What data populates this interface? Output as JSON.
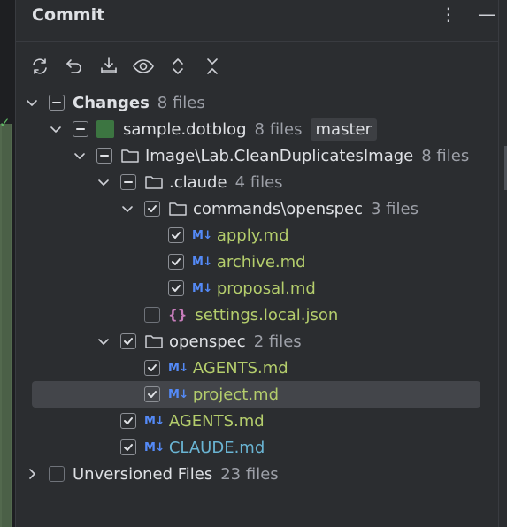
{
  "panel": {
    "title": "Commit",
    "more_icon": "more-vertical-icon",
    "minimize_icon": "minimize-icon"
  },
  "toolbar": {
    "icons": [
      "refresh-icon",
      "rollback-icon",
      "shelve-icon",
      "preview-icon",
      "expand-all-icon",
      "collapse-all-icon"
    ]
  },
  "tree": {
    "changes": {
      "label": "Changes",
      "count": "8 files"
    },
    "module": {
      "label": "sample.dotblog",
      "count": "8 files",
      "branch": "master"
    },
    "image_folder": {
      "label": "Image\\Lab.CleanDuplicatesImage",
      "count": "8 files"
    },
    "claude_folder": {
      "label": ".claude",
      "count": "4 files"
    },
    "commands_folder": {
      "label": "commands\\openspec",
      "count": "3 files"
    },
    "apply": {
      "label": "apply.md",
      "icon": "M↓"
    },
    "archive": {
      "label": "archive.md",
      "icon": "M↓"
    },
    "proposal": {
      "label": "proposal.md",
      "icon": "M↓"
    },
    "settings": {
      "label": "settings.local.json",
      "icon": "{}"
    },
    "openspec_folder": {
      "label": "openspec",
      "count": "2 files"
    },
    "agents_inner": {
      "label": "AGENTS.md",
      "icon": "M↓"
    },
    "project": {
      "label": "project.md",
      "icon": "M↓"
    },
    "agents_root": {
      "label": "AGENTS.md",
      "icon": "M↓"
    },
    "claude_md": {
      "label": "CLAUDE.md",
      "icon": "M↓"
    },
    "unversioned": {
      "label": "Unversioned Files",
      "count": "23 files"
    }
  },
  "colors": {
    "background": "#2b2d30",
    "added_file": "#b4cd6c",
    "modified_file": "#6ab5d4",
    "markdown_icon": "#548af7",
    "selection": "#43454a"
  }
}
